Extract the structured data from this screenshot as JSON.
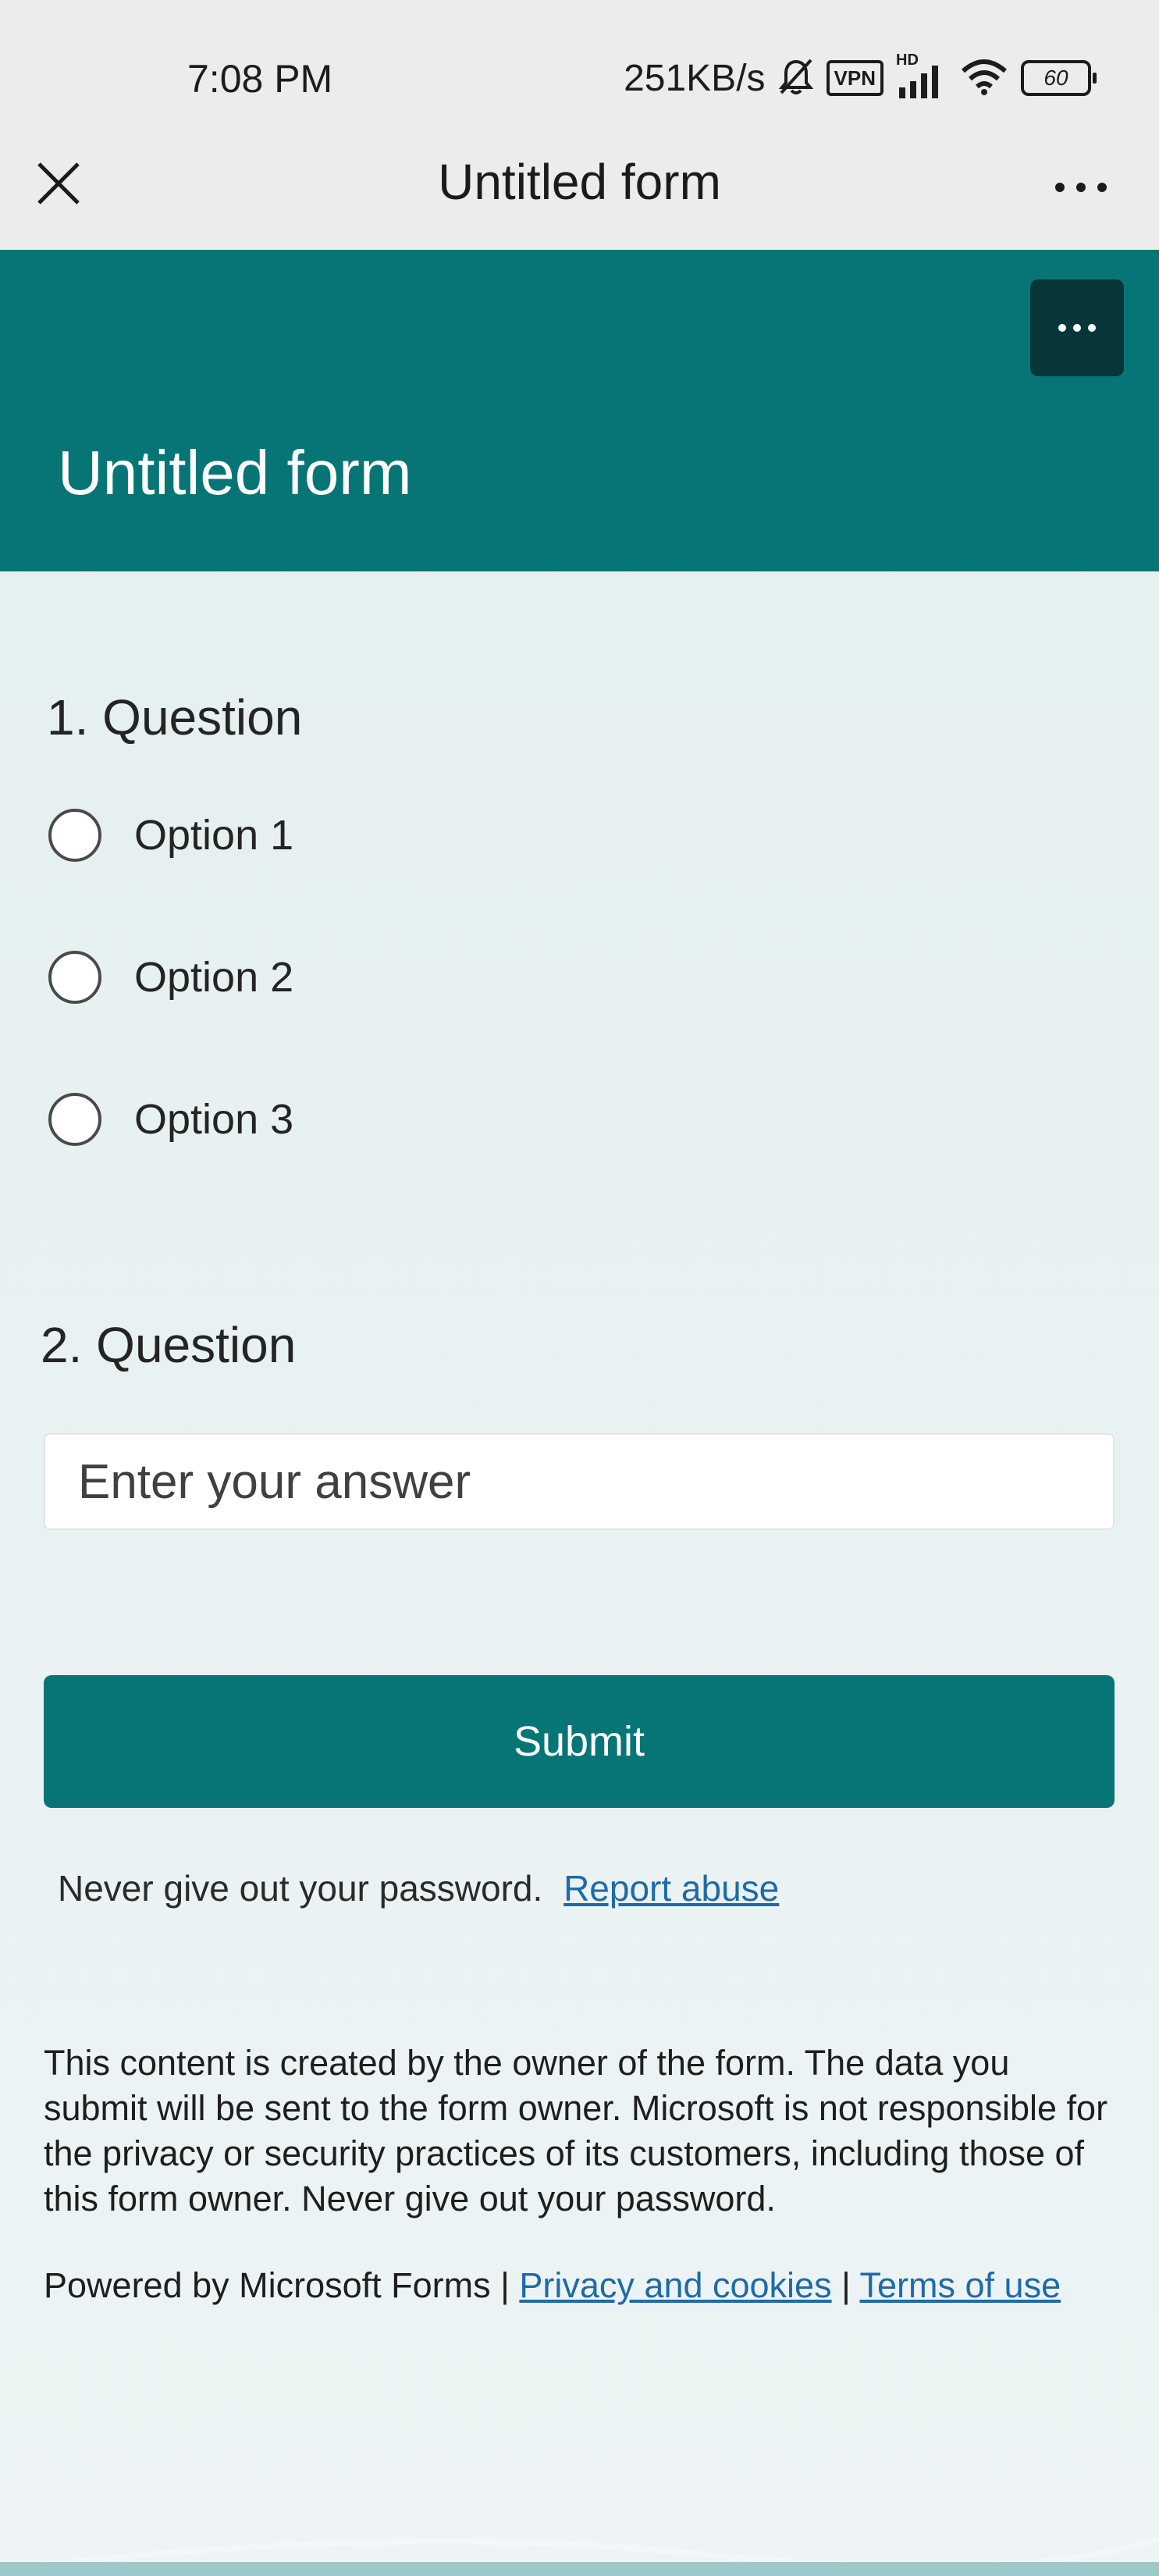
{
  "status_bar": {
    "time": "7:08 PM",
    "net_speed": "251KB/s",
    "vpn_label": "VPN",
    "hd_label": "HD",
    "battery_level": "60"
  },
  "app_bar": {
    "title": "Untitled form"
  },
  "banner": {
    "form_title": "Untitled form"
  },
  "questions": [
    {
      "number": "1.",
      "title": "Question",
      "options": [
        "Option 1",
        "Option 2",
        "Option 3"
      ]
    },
    {
      "number": "2.",
      "title": "Question",
      "placeholder": "Enter your answer"
    }
  ],
  "submit_label": "Submit",
  "warning": {
    "text": "Never give out your password.",
    "report_link": "Report abuse"
  },
  "disclaimer": "This content is created by the owner of the form. The data you submit will be sent to the form owner. Microsoft is not responsible for the privacy or security practices of its customers, including those of this form owner. Never give out your password.",
  "footer": {
    "powered_by": "Powered by Microsoft Forms",
    "separator": "|",
    "privacy_link": "Privacy and cookies",
    "terms_link": "Terms of use"
  },
  "colors": {
    "accent": "#077575",
    "accent_dark": "#063637",
    "link": "#1f6aa7"
  }
}
